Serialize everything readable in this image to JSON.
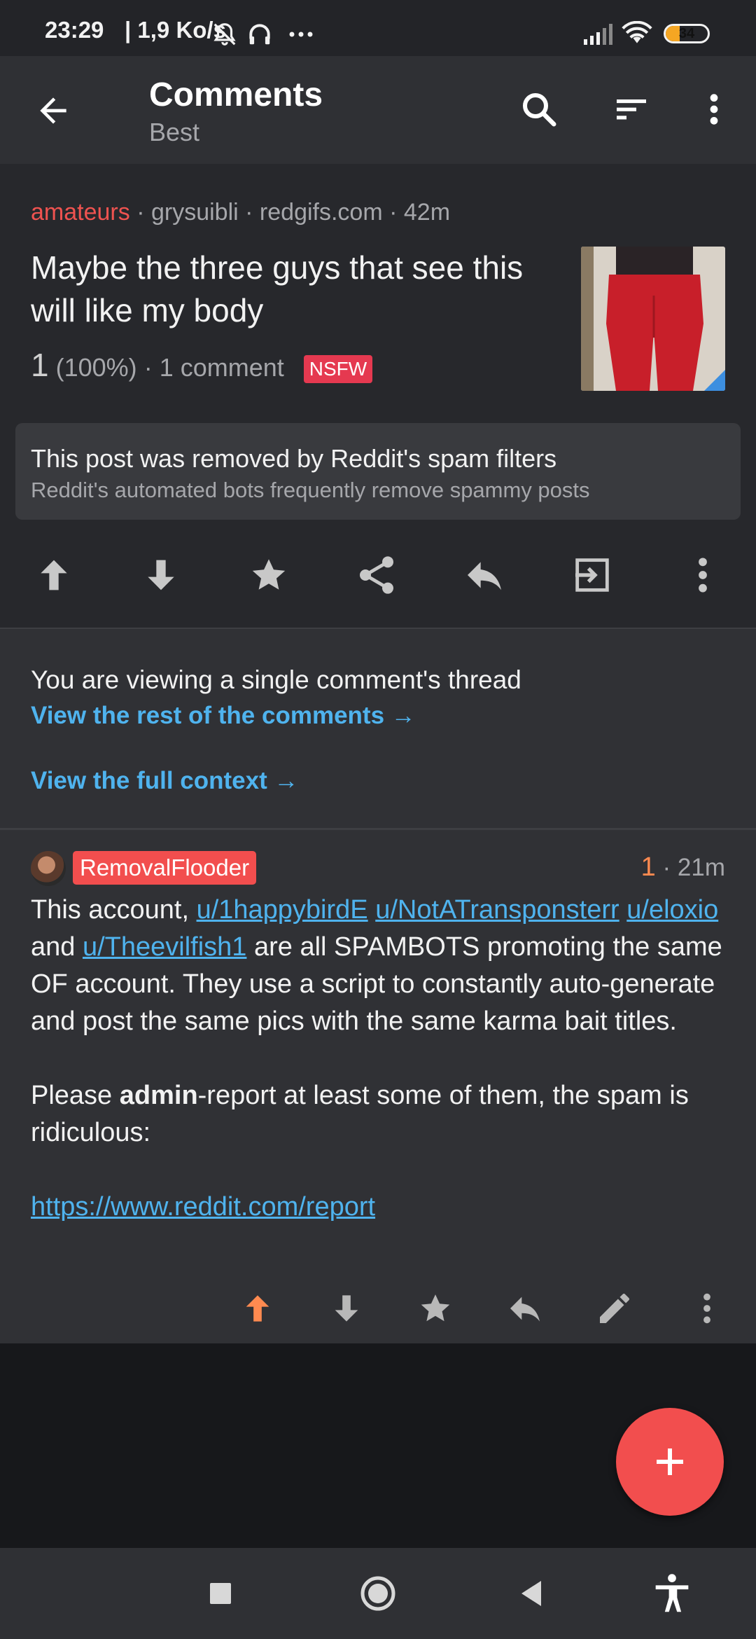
{
  "status_bar": {
    "time": "23:29",
    "network_speed": "| 1,9 Ko/s",
    "battery": "34",
    "battery_level": 0.34,
    "battery_color": "#f5a623"
  },
  "toolbar": {
    "title": "Comments",
    "sort": "Best",
    "icons": [
      "back-arrow-icon",
      "search-icon",
      "sort-icon",
      "more-vertical-icon"
    ]
  },
  "post": {
    "subreddit": "amateurs",
    "author": "grysuibli",
    "domain": "redgifs.com",
    "age": "42m",
    "title": "Maybe the three guys that see this will like my body",
    "score": "1",
    "upvote_ratio": "(100%)",
    "comments": "1 comment",
    "nsfw_label": "NSFW",
    "removed_notice": "This post was removed by Reddit's spam filters",
    "removed_detail": "Reddit's automated bots frequently remove spammy posts",
    "actions": [
      "upvote-icon",
      "downvote-icon",
      "star-icon",
      "share-icon",
      "reply-icon",
      "open-icon",
      "more-vertical-icon"
    ]
  },
  "thread_notice": {
    "message": "You are viewing a single comment's thread",
    "rest_link": "View the rest of the comments →",
    "context_link": "View the full context →"
  },
  "comment": {
    "author": "RemovalFlooder",
    "score": "1",
    "age": "· 21m",
    "text_1a": "This account, ",
    "link_1": "u/1happybirdE",
    "link_2": "u/NotATransponsterr",
    "link_3": "u/eloxio",
    "text_1b": " and ",
    "link_4": "u/Theevilfish1",
    "text_1c": " are all SPAMBOTS promoting the same OF account. They use a script to constantly auto-generate and post the same pics with the same karma bait titles.",
    "text_2a": "Please ",
    "text_2_bold": "admin",
    "text_2b": "-report at least some of them, the spam is ridiculous:",
    "report_link": "https://www.reddit.com/report",
    "actions": [
      "upvote-icon",
      "downvote-icon",
      "star-icon",
      "reply-icon",
      "edit-icon",
      "more-vertical-icon"
    ]
  },
  "colors": {
    "accent_link": "#4fb3ee",
    "subreddit": "#ef5350",
    "upvoted": "#ff8a50",
    "fab": "#f24e4e"
  }
}
